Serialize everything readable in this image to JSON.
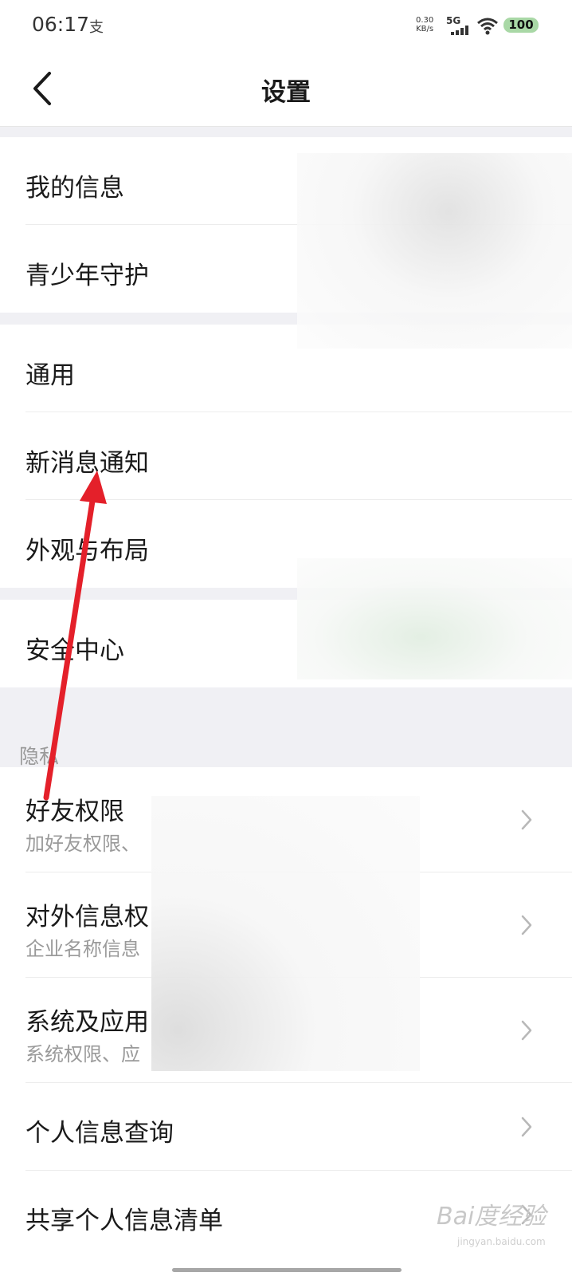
{
  "status_bar": {
    "time": "06:17",
    "extra_icon": "支",
    "net_speed_value": "0.30",
    "net_speed_unit": "KB/s",
    "network": "5G",
    "battery": "100",
    "battery_color": "#a9d8a6"
  },
  "header": {
    "title": "设置",
    "back_icon": "chevron-left-icon"
  },
  "settings": {
    "group1": [
      {
        "label": "我的信息"
      },
      {
        "label": "青少年守护"
      }
    ],
    "group2": [
      {
        "label": "通用"
      },
      {
        "label": "新消息通知"
      },
      {
        "label": "外观与布局"
      }
    ],
    "group3": [
      {
        "label": "安全中心"
      }
    ]
  },
  "privacy": {
    "section_title": "隐私",
    "items": [
      {
        "label": "好友权限",
        "sub": "加好友权限、"
      },
      {
        "label": "对外信息权",
        "sub": "企业名称信息"
      },
      {
        "label": "系统及应用",
        "sub": "系统权限、应"
      },
      {
        "label": "个人信息查询"
      },
      {
        "label": "共享个人信息清单"
      }
    ]
  },
  "watermark": {
    "text": "Bai度经验",
    "sub": "jingyan.baidu.com"
  },
  "colors": {
    "arrow": "#e4202a",
    "gap_bg": "#f0f0f4"
  }
}
